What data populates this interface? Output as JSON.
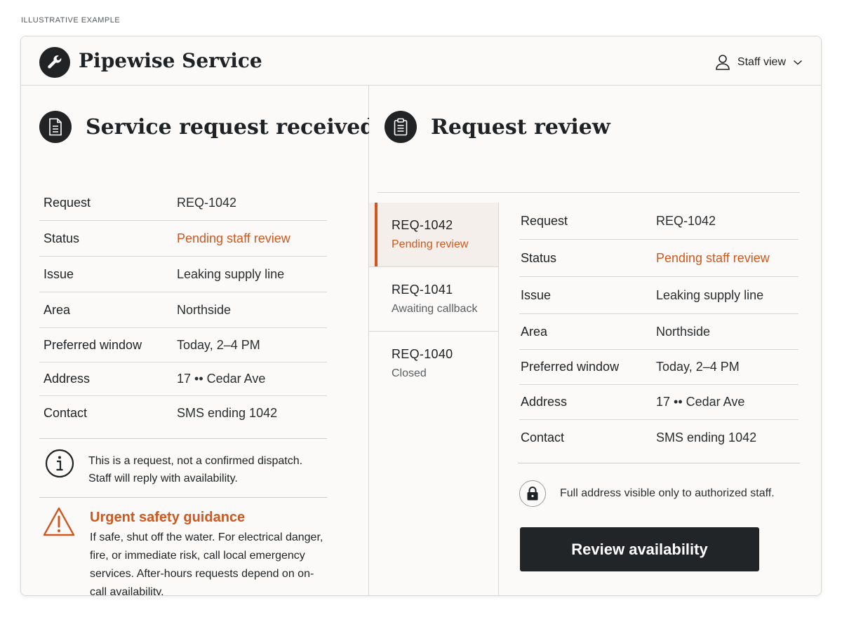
{
  "corner_label": "ILLUSTRATIVE EXAMPLE",
  "header": {
    "brand": "Pipewise Service",
    "view_label": "Staff view"
  },
  "left": {
    "title": "Service request received",
    "rows": [
      {
        "key": "Request",
        "value": "REQ-1042"
      },
      {
        "key": "Status",
        "value": "Pending staff review"
      },
      {
        "key": "Issue",
        "value": "Leaking supply line"
      },
      {
        "key": "Area",
        "value": "Northside"
      },
      {
        "key": "Preferred window",
        "value": "Today, 2–4 PM"
      },
      {
        "key": "Address",
        "value": "17 •• Cedar Ave"
      },
      {
        "key": "Contact",
        "value": "SMS ending 1042"
      }
    ],
    "notice": "This is a request, not a confirmed dispatch. Staff will reply with availability.",
    "urgent_title": "Urgent safety guidance",
    "urgent_text": "If safe, shut off the water. For electrical danger, fire, or immediate risk, call local emergency services. After-hours requests depend on on-call availability."
  },
  "right": {
    "title": "Request review",
    "requests": [
      {
        "id": "REQ-1042",
        "status": "Pending review",
        "active": true
      },
      {
        "id": "REQ-1041",
        "status": "Awaiting callback",
        "active": false
      },
      {
        "id": "REQ-1040",
        "status": "Closed",
        "active": false
      }
    ],
    "rows": [
      {
        "key": "Request",
        "value": "REQ-1042"
      },
      {
        "key": "Status",
        "value": "Pending staff review"
      },
      {
        "key": "Issue",
        "value": "Leaking supply line"
      },
      {
        "key": "Area",
        "value": "Northside"
      },
      {
        "key": "Preferred window",
        "value": "Today, 2–4 PM"
      },
      {
        "key": "Address",
        "value": "17 •• Cedar Ave"
      },
      {
        "key": "Contact",
        "value": "SMS ending 1042"
      }
    ],
    "lock_note": "Full address visible only to authorized staff.",
    "review_button": "Review availability"
  },
  "colors": {
    "accent": "#d0571e",
    "dark": "#212325",
    "background": "#fbfaf8"
  },
  "icons": [
    "wrench-icon",
    "user-icon",
    "chevron-down-icon",
    "document-icon",
    "clipboard-icon",
    "info-icon",
    "warning-icon",
    "lock-icon"
  ]
}
